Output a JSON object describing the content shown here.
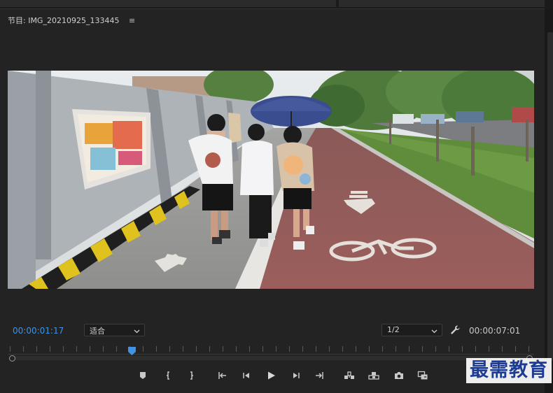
{
  "panel": {
    "title": "节目: IMG_20210925_133445",
    "menu_icon": "hamburger-icon"
  },
  "timecode": {
    "current": "00:00:01:17",
    "duration": "00:00:07:01",
    "current_color": "#3f93e6"
  },
  "zoom": {
    "selected": "适合"
  },
  "resolution": {
    "selected": "1/2"
  },
  "playhead": {
    "fraction": 0.235
  },
  "controls": {
    "icons": [
      "marker-icon",
      "mark-in-icon",
      "mark-out-icon",
      "go-to-in-icon",
      "step-back-icon",
      "play-icon",
      "step-forward-icon",
      "go-to-out-icon",
      "insert-icon",
      "overwrite-icon",
      "camera-icon",
      "button-editor-icon"
    ]
  },
  "watermark": {
    "text": "最需教育"
  }
}
